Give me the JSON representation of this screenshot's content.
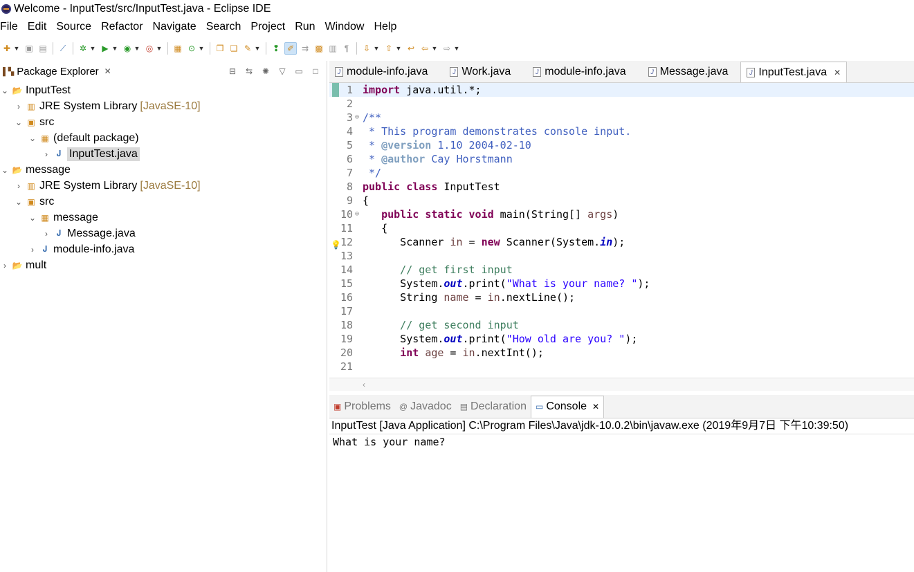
{
  "window": {
    "title": "Welcome - InputTest/src/InputTest.java - Eclipse IDE"
  },
  "menu": [
    "File",
    "Edit",
    "Source",
    "Refactor",
    "Navigate",
    "Search",
    "Project",
    "Run",
    "Window",
    "Help"
  ],
  "package_explorer": {
    "title": "Package Explorer",
    "tree": {
      "inputtest": "InputTest",
      "jre1": "JRE System Library",
      "jre1_decor": "[JavaSE-10]",
      "src1": "src",
      "default_pkg": "(default package)",
      "inputtest_java": "InputTest.java",
      "message": "message",
      "jre2": "JRE System Library",
      "jre2_decor": "[JavaSE-10]",
      "src2": "src",
      "message_pkg": "message",
      "message_java": "Message.java",
      "module_info": "module-info.java",
      "mult": "mult"
    }
  },
  "editor": {
    "tabs": [
      "module-info.java",
      "Work.java",
      "module-info.java",
      "Message.java",
      "InputTest.java"
    ],
    "active_tab": "InputTest.java",
    "lines": [
      {
        "n": "1",
        "t": "import java.util.*;"
      },
      {
        "n": "2",
        "t": ""
      },
      {
        "n": "3",
        "t": "/**"
      },
      {
        "n": "4",
        "t": " * This program demonstrates console input."
      },
      {
        "n": "5",
        "t": " * @version 1.10 2004-02-10"
      },
      {
        "n": "6",
        "t": " * @author Cay Horstmann"
      },
      {
        "n": "7",
        "t": " */"
      },
      {
        "n": "8",
        "t": "public class InputTest"
      },
      {
        "n": "9",
        "t": "{"
      },
      {
        "n": "10",
        "t": "   public static void main(String[] args)"
      },
      {
        "n": "11",
        "t": "   {"
      },
      {
        "n": "12",
        "t": "      Scanner in = new Scanner(System.in);"
      },
      {
        "n": "13",
        "t": ""
      },
      {
        "n": "14",
        "t": "      // get first input"
      },
      {
        "n": "15",
        "t": "      System.out.print(\"What is your name? \");"
      },
      {
        "n": "16",
        "t": "      String name = in.nextLine();"
      },
      {
        "n": "17",
        "t": ""
      },
      {
        "n": "18",
        "t": "      // get second input"
      },
      {
        "n": "19",
        "t": "      System.out.print(\"How old are you? \");"
      },
      {
        "n": "20",
        "t": "      int age = in.nextInt();"
      },
      {
        "n": "21",
        "t": ""
      }
    ]
  },
  "bottom_panel": {
    "tabs": [
      "Problems",
      "Javadoc",
      "Declaration",
      "Console"
    ],
    "active_tab": "Console",
    "console_label": "InputTest [Java Application] C:\\Program Files\\Java\\jdk-10.0.2\\bin\\javaw.exe (2019年9月7日 下午10:39:50)",
    "console_output": "What is your name?"
  },
  "colors": {
    "keyword": "#7f0055",
    "comment": "#3f7f5f",
    "javadoc": "#3f5fbf",
    "string": "#2a00ff",
    "current_line": "#e8f2fe",
    "library_decoration": "#9b7a3e"
  }
}
